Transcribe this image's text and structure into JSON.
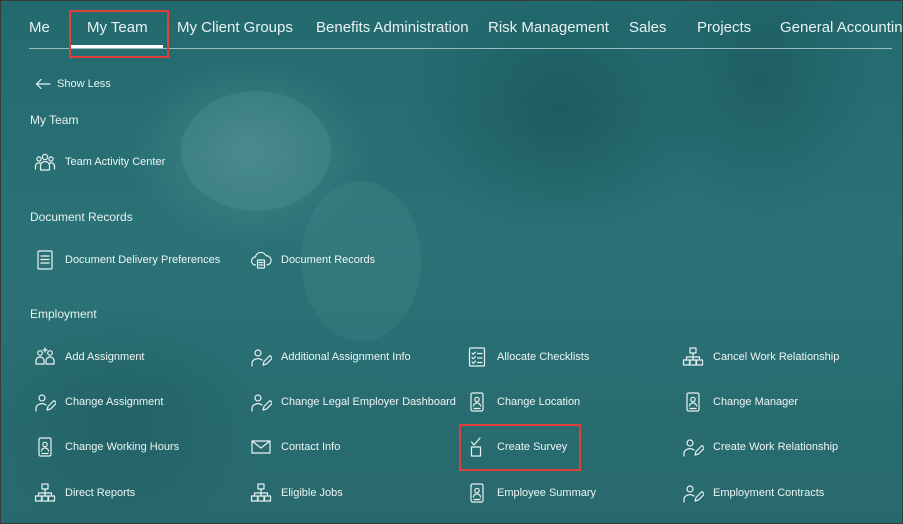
{
  "topnav": {
    "tabs": [
      "Me",
      "My Team",
      "My Client Groups",
      "Benefits Administration",
      "Risk Management",
      "Sales",
      "Projects",
      "General Accounting"
    ]
  },
  "show_less": "Show Less",
  "sections": {
    "my_team": {
      "title": "My Team",
      "items": [
        {
          "label": "Team Activity Center",
          "icon": "people-group-icon"
        }
      ]
    },
    "document_records": {
      "title": "Document Records",
      "items": [
        {
          "label": "Document Delivery Preferences",
          "icon": "document-list-icon"
        },
        {
          "label": "Document Records",
          "icon": "cloud-document-icon"
        }
      ]
    },
    "employment": {
      "title": "Employment",
      "items": [
        {
          "label": "Add Assignment",
          "icon": "people-add-icon"
        },
        {
          "label": "Additional Assignment Info",
          "icon": "person-pen-icon"
        },
        {
          "label": "Allocate Checklists",
          "icon": "checklist-icon"
        },
        {
          "label": "Cancel Work Relationship",
          "icon": "org-chart-icon"
        },
        {
          "label": "Change Assignment",
          "icon": "person-pen-icon"
        },
        {
          "label": "Change Legal Employer Dashboard",
          "icon": "person-pen-icon"
        },
        {
          "label": "Change Location",
          "icon": "id-badge-icon"
        },
        {
          "label": "Change Manager",
          "icon": "id-badge-icon"
        },
        {
          "label": "Change Working Hours",
          "icon": "id-badge-icon"
        },
        {
          "label": "Contact Info",
          "icon": "envelope-icon"
        },
        {
          "label": "Create Survey",
          "icon": "survey-checkbox-icon"
        },
        {
          "label": "Create Work Relationship",
          "icon": "person-pen-icon"
        },
        {
          "label": "Direct Reports",
          "icon": "org-chart-icon"
        },
        {
          "label": "Eligible Jobs",
          "icon": "org-chart-icon"
        },
        {
          "label": "Employee Summary",
          "icon": "id-badge-icon"
        },
        {
          "label": "Employment Contracts",
          "icon": "person-pen-icon"
        }
      ]
    }
  },
  "colors": {
    "background": "#2a6e72",
    "highlight_box": "#e0403a",
    "text": "#e9f2f2"
  }
}
